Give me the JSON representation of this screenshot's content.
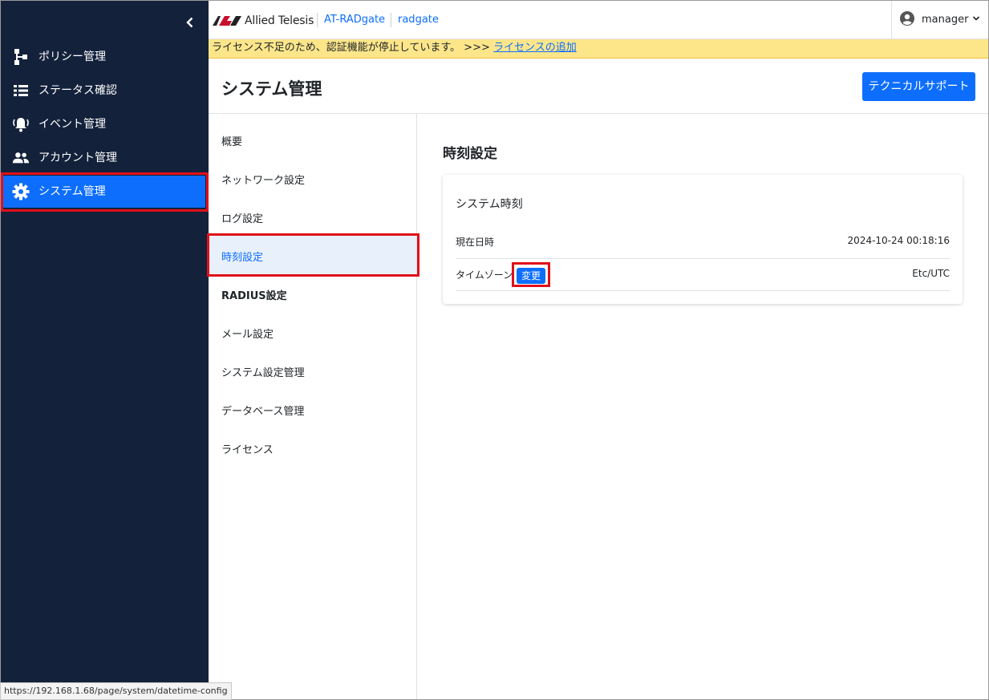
{
  "brand": {
    "logo_text": "Allied Telesis",
    "product": "AT-RADgate",
    "host": "radgate"
  },
  "user": {
    "name": "manager"
  },
  "banner": {
    "message": "ライセンス不足のため、認証機能が停止しています。 >>>",
    "link": "ライセンスの追加"
  },
  "sidebar": {
    "items": [
      {
        "label": "ポリシー管理",
        "icon": "policy-tree-icon"
      },
      {
        "label": "ステータス確認",
        "icon": "list-icon"
      },
      {
        "label": "イベント管理",
        "icon": "bell-icon"
      },
      {
        "label": "アカウント管理",
        "icon": "people-icon"
      },
      {
        "label": "システム管理",
        "icon": "gear-icon",
        "active": true
      }
    ]
  },
  "page": {
    "title": "システム管理",
    "support_button": "テクニカルサポート"
  },
  "submenu": {
    "items": [
      {
        "label": "概要"
      },
      {
        "label": "ネットワーク設定"
      },
      {
        "label": "ログ設定"
      },
      {
        "label": "時刻設定",
        "active": true
      },
      {
        "label": "RADIUS設定"
      },
      {
        "label": "メール設定"
      },
      {
        "label": "システム設定管理"
      },
      {
        "label": "データベース管理"
      },
      {
        "label": "ライセンス"
      }
    ]
  },
  "content": {
    "section_title": "時刻設定",
    "card_title": "システム時刻",
    "rows": [
      {
        "key": "現在日時",
        "value": "2024-10-24 00:18:16"
      },
      {
        "key": "タイムゾーン",
        "value": "Etc/UTC",
        "button": "変更"
      }
    ]
  },
  "status_bar": {
    "url": "https://192.168.1.68/page/system/datetime-config"
  },
  "colors": {
    "sidebar_bg": "#13213b",
    "accent": "#0d6efd",
    "banner_bg": "#fde68a",
    "highlight": "#e0101a"
  }
}
